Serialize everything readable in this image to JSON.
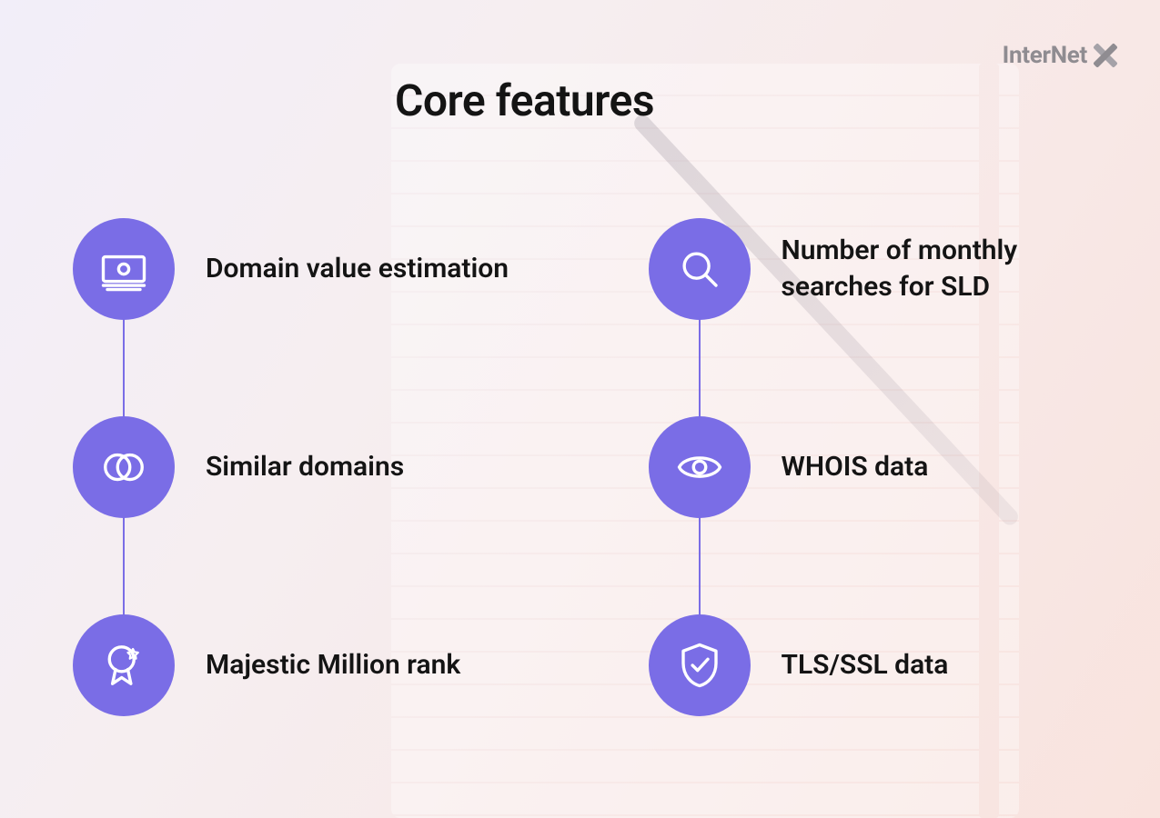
{
  "logo": {
    "text": "InterNet"
  },
  "title": "Core features",
  "colors": {
    "accent": "#7a6de6"
  },
  "columns": [
    {
      "items": [
        {
          "icon": "money-icon",
          "label": "Domain value estimation"
        },
        {
          "icon": "overlap-icon",
          "label": "Similar domains"
        },
        {
          "icon": "award-icon",
          "label": "Majestic Million rank"
        }
      ]
    },
    {
      "items": [
        {
          "icon": "search-icon",
          "label": "Number of monthly searches for SLD"
        },
        {
          "icon": "eye-icon",
          "label": "WHOIS data"
        },
        {
          "icon": "shield-icon",
          "label": "TLS/SSL data"
        }
      ]
    }
  ]
}
